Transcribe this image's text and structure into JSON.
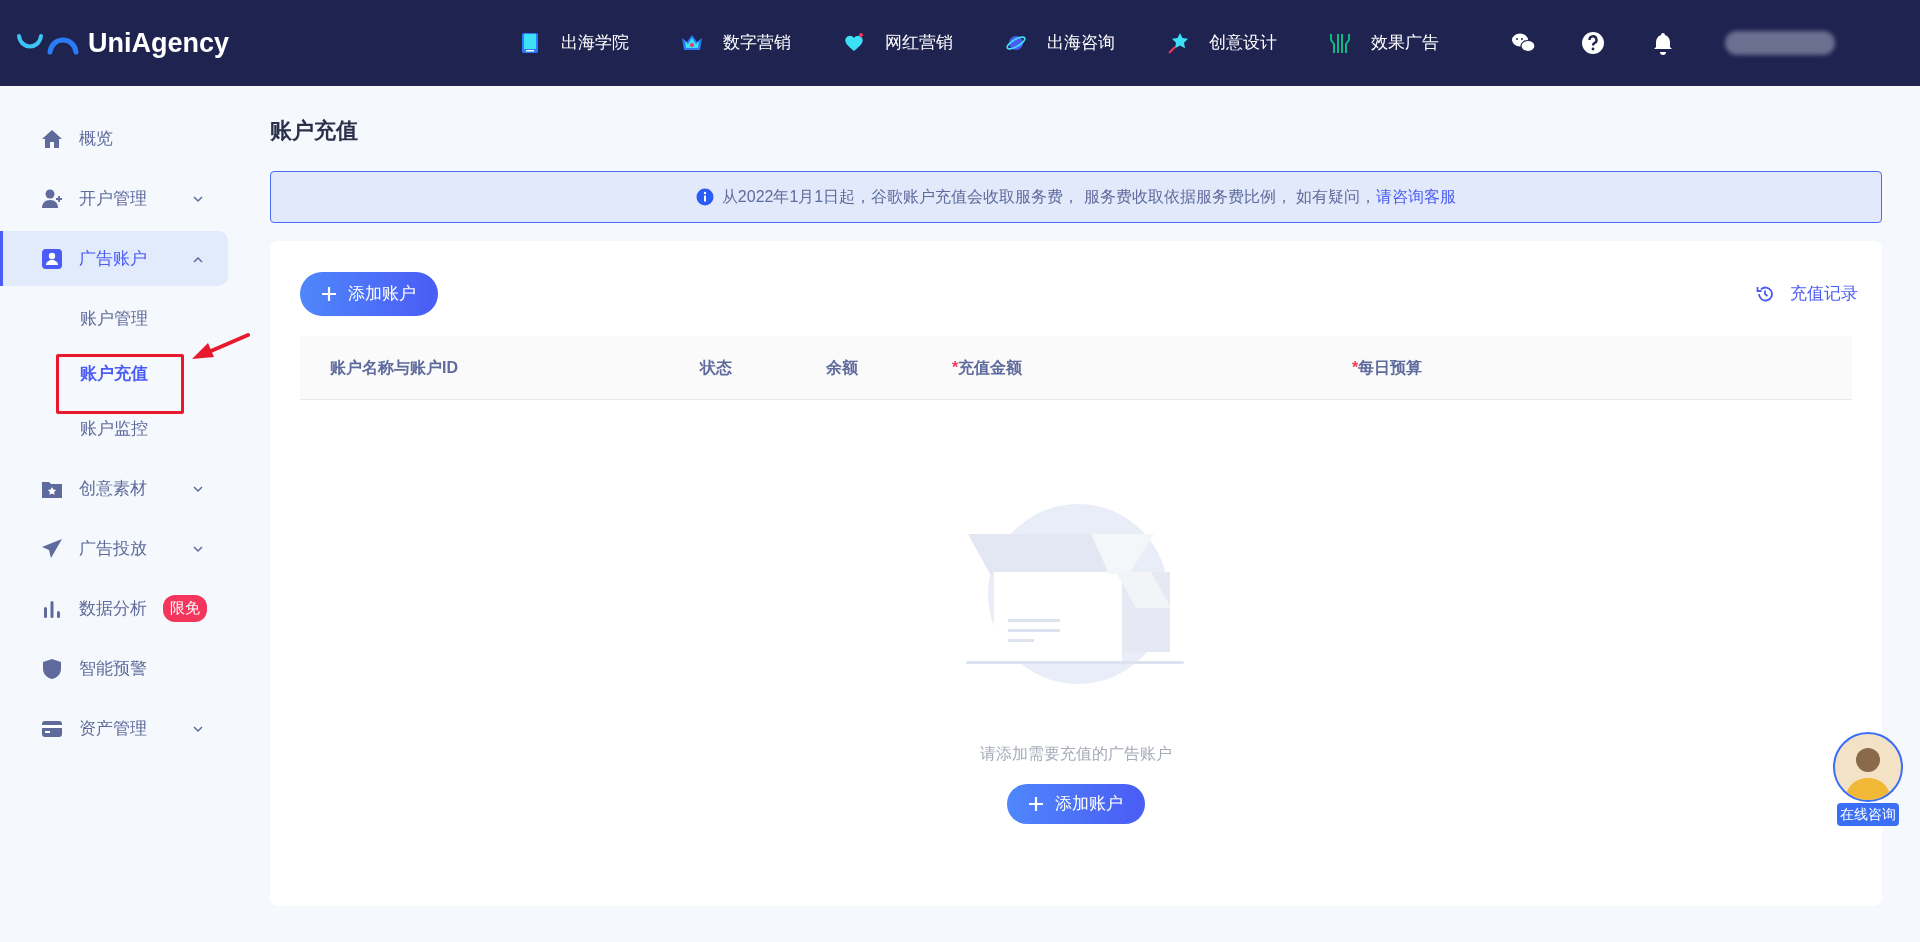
{
  "header": {
    "logo": "UniAgency",
    "nav": [
      {
        "label": "出海学院"
      },
      {
        "label": "数字营销"
      },
      {
        "label": "网红营销"
      },
      {
        "label": "出海咨询"
      },
      {
        "label": "创意设计"
      },
      {
        "label": "效果广告"
      }
    ]
  },
  "sidebar": {
    "items": [
      {
        "label": "概览",
        "selected": false
      },
      {
        "label": "开户管理",
        "selected": false,
        "expanded": false
      },
      {
        "label": "广告账户",
        "selected": true,
        "expanded": true,
        "children": [
          {
            "label": "账户管理",
            "selected": false
          },
          {
            "label": "账户充值",
            "selected": true
          },
          {
            "label": "账户监控",
            "selected": false
          }
        ]
      },
      {
        "label": "创意素材",
        "selected": false,
        "expanded": false
      },
      {
        "label": "广告投放",
        "selected": false,
        "expanded": false
      },
      {
        "label": "数据分析",
        "selected": false,
        "badge": "限免"
      },
      {
        "label": "智能预警",
        "selected": false
      },
      {
        "label": "资产管理",
        "selected": false,
        "expanded": false
      }
    ]
  },
  "page": {
    "title": "账户充值",
    "notice": {
      "text": "从2022年1月1日起，谷歌账户充值会收取服务费， 服务费收取依据服务费比例， 如有疑问，",
      "link": "请咨询客服"
    },
    "add_button": "添加账户",
    "history_link": "充值记录",
    "table": {
      "columns": [
        {
          "label": "账户名称与账户ID"
        },
        {
          "label": "状态"
        },
        {
          "label": "余额"
        },
        {
          "label": "充值金额",
          "required_mark": "*"
        },
        {
          "label": "每日预算",
          "required_mark": "*"
        }
      ]
    },
    "empty": {
      "message": "请添加需要充值的广告账户",
      "button": "添加账户"
    }
  },
  "chat_widget": {
    "label": "在线咨询"
  }
}
